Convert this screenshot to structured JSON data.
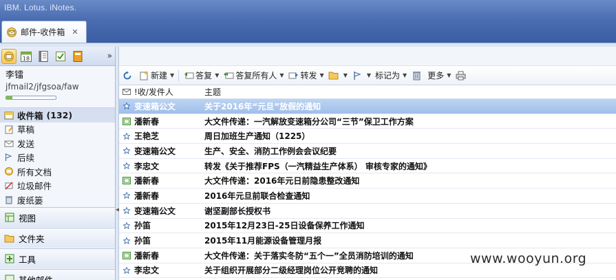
{
  "app": {
    "brand": "IBM. Lotus. iNotes."
  },
  "tab": {
    "label": "邮件-收件箱",
    "close": "✕"
  },
  "user": {
    "name": "李镭",
    "id": "jfmail2/jfgsoa/faw",
    "quota_fraction": 0.12
  },
  "nav": {
    "more": "»"
  },
  "folders": [
    {
      "label": "收件箱",
      "count": "(132)",
      "icon": "inbox-icon",
      "selected": true
    },
    {
      "label": "草稿",
      "icon": "drafts-icon"
    },
    {
      "label": "发送",
      "icon": "sent-icon"
    },
    {
      "label": "后续",
      "icon": "follow-up-icon"
    },
    {
      "label": "所有文档",
      "icon": "all-documents-icon"
    },
    {
      "label": "垃圾邮件",
      "icon": "junk-icon"
    },
    {
      "label": "废纸篓",
      "icon": "trash-icon"
    }
  ],
  "accordion": [
    {
      "label": "视图",
      "icon": "views-icon"
    },
    {
      "label": "文件夹",
      "icon": "folder-icon"
    },
    {
      "label": "工具",
      "icon": "tools-icon"
    },
    {
      "label": "其他邮件",
      "icon": "other-mail-icon"
    }
  ],
  "toolbar": {
    "new": "新建",
    "reply": "答复",
    "reply_all": "答复所有人",
    "forward": "转发",
    "mark_as": "标记为",
    "more": "更多"
  },
  "columns": {
    "from": "!收/发件人",
    "subject": "主题"
  },
  "messages": [
    {
      "icon": "star",
      "from": "变速箱公文",
      "subject": "关于2016年“元旦”放假的通知",
      "selected": true
    },
    {
      "icon": "mail",
      "from": "潘新春",
      "subject": "大文件传递：一汽解放变速箱分公司“三节”保卫工作方案"
    },
    {
      "icon": "star",
      "from": "王艳芝",
      "subject": "周日加班生产通知（1225）"
    },
    {
      "icon": "star",
      "from": "变速箱公文",
      "subject": "生产、安全、消防工作例会会议纪要"
    },
    {
      "icon": "star",
      "from": "李忠文",
      "subject": "转发《关于推荐FPS（一汽精益生产体系） 审核专家的通知》"
    },
    {
      "icon": "mail",
      "from": "潘新春",
      "subject": "大文件传递：2016年元日前隐患整改通知"
    },
    {
      "icon": "star",
      "from": "潘新春",
      "subject": "2016年元旦前联合检查通知"
    },
    {
      "icon": "star",
      "from": "变速箱公文",
      "subject": "谢坚副部长授权书"
    },
    {
      "icon": "star",
      "from": "孙笛",
      "subject": "2015年12月23日-25日设备保养工作通知"
    },
    {
      "icon": "star",
      "from": "孙笛",
      "subject": "2015年11月能源设备管理月报"
    },
    {
      "icon": "mail",
      "from": "潘新春",
      "subject": "大文件传递：关于落实冬防“五个一”全员消防培训的通知"
    },
    {
      "icon": "star",
      "from": "李忠文",
      "subject": "关于组织开展部分二级经理岗位公开竞聘的通知"
    }
  ],
  "watermark": "www.wooyun.org"
}
